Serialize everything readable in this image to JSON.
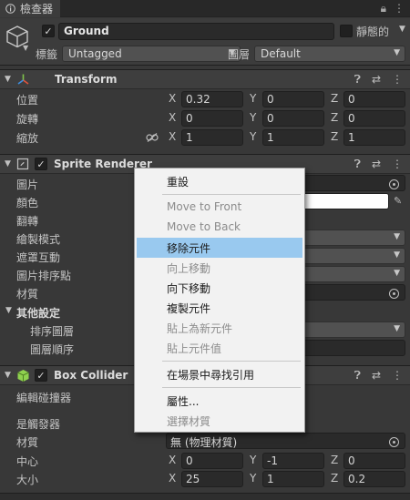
{
  "tab": {
    "title": "檢查器"
  },
  "header": {
    "active": true,
    "name": "Ground",
    "static_label": "靜態的",
    "tag_label": "標籤",
    "tag_value": "Untagged",
    "layer_label": "圖層",
    "layer_value": "Default"
  },
  "transform": {
    "title": "Transform",
    "rows": [
      {
        "label": "位置",
        "x": "0.32",
        "y": "0",
        "z": "0"
      },
      {
        "label": "旋轉",
        "x": "0",
        "y": "0",
        "z": "0"
      },
      {
        "label": "縮放",
        "x": "1",
        "y": "1",
        "z": "1"
      }
    ]
  },
  "axes": {
    "x": "X",
    "y": "Y",
    "z": "Z"
  },
  "sprite_renderer": {
    "title": "Sprite Renderer",
    "active": true,
    "labels": [
      "圖片",
      "顏色",
      "翻轉",
      "繪製模式",
      "遮罩互動",
      "圖片排序點",
      "材質"
    ],
    "other_settings": "其他設定",
    "sub_labels": [
      "排序圖層",
      "圖層順序"
    ]
  },
  "box_collider": {
    "title": "Box Collider",
    "active": true,
    "edit_label": "編輯碰撞器",
    "trigger_label": "是觸發器",
    "material_label": "材質",
    "material_value": "無 (物理材質)",
    "center_label": "中心",
    "center": {
      "x": "0",
      "y": "-1",
      "z": "0"
    },
    "size_label": "大小",
    "size": {
      "x": "25",
      "y": "1",
      "z": "0.2"
    }
  },
  "context_menu": {
    "items": [
      {
        "label": "重設",
        "disabled": false
      },
      {
        "label": "Move to Front",
        "disabled": true
      },
      {
        "label": "Move to Back",
        "disabled": true
      },
      {
        "label": "移除元件",
        "disabled": false,
        "highlighted": true
      },
      {
        "label": "向上移動",
        "disabled": true
      },
      {
        "label": "向下移動",
        "disabled": false
      },
      {
        "label": "複製元件",
        "disabled": false
      },
      {
        "label": "貼上為新元件",
        "disabled": true
      },
      {
        "label": "貼上元件值",
        "disabled": true
      },
      {
        "label": "在場景中尋找引用",
        "disabled": false
      },
      {
        "label": "屬性...",
        "disabled": false
      },
      {
        "label": "選擇材質",
        "disabled": true
      }
    ]
  },
  "colors": {
    "panel_bg": "#383838",
    "menu_highlight": "#99c9ef",
    "transform_icon_red": "#e0533d",
    "transform_icon_green": "#7fc34a",
    "transform_icon_blue": "#3d8fe0",
    "collider_icon_green": "#8fd14f"
  }
}
